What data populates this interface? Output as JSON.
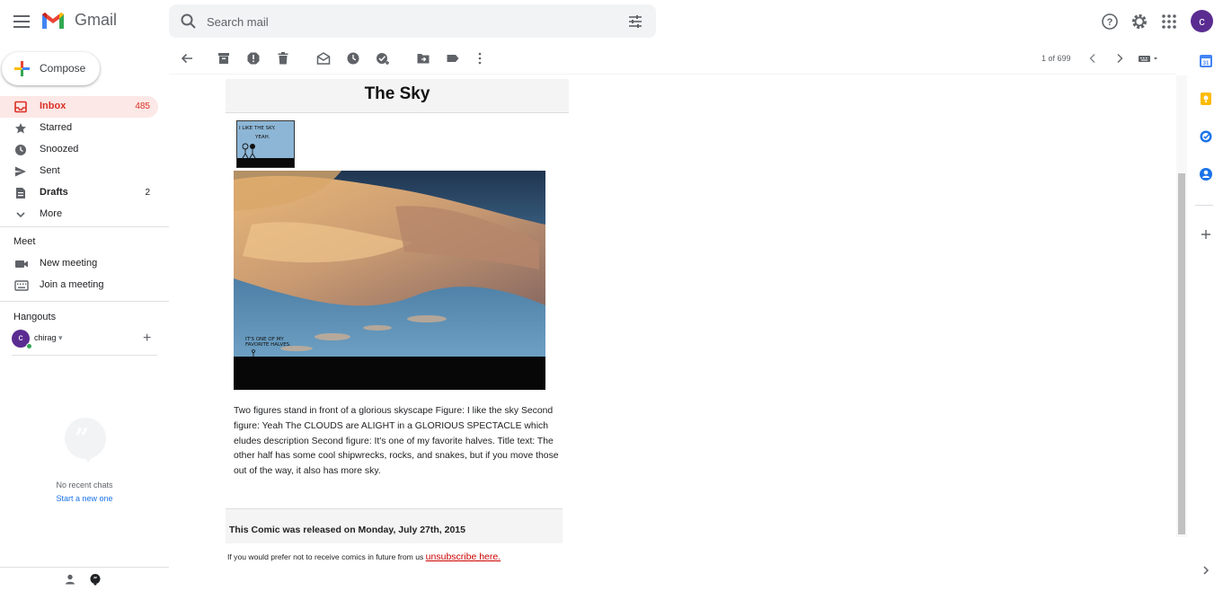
{
  "header": {
    "app_name": "Gmail",
    "search_placeholder": "Search mail",
    "avatar_letter": "c"
  },
  "sidebar": {
    "compose_label": "Compose",
    "items": [
      {
        "label": "Inbox",
        "count": "485",
        "icon": "inbox-icon",
        "active": true
      },
      {
        "label": "Starred",
        "count": "",
        "icon": "star-icon"
      },
      {
        "label": "Snoozed",
        "count": "",
        "icon": "clock-icon"
      },
      {
        "label": "Sent",
        "count": "",
        "icon": "send-icon"
      },
      {
        "label": "Drafts",
        "count": "2",
        "icon": "draft-icon"
      },
      {
        "label": "More",
        "count": "",
        "icon": "chevron-down-icon"
      }
    ],
    "meet": {
      "title": "Meet",
      "new_meeting": "New meeting",
      "join_meeting": "Join a meeting"
    },
    "hangouts": {
      "title": "Hangouts",
      "user_letter": "c",
      "user_name": "chirag",
      "no_chats": "No recent chats",
      "start_new": "Start a new one"
    }
  },
  "toolbar": {
    "pager": "1 of 699"
  },
  "email": {
    "title": "The Sky",
    "thumb_text_1": "I LIKE THE SKY.",
    "thumb_text_2": "YEAH.",
    "image_caption_1": "IT'S ONE OF MY",
    "image_caption_2": "FAVORITE HALVES.",
    "description": "Two figures stand in front of a glorious skyscape Figure: I like the sky Second figure: Yeah The CLOUDS are ALIGHT in a GLORIOUS SPECTACLE which eludes description Second figure: It's one of my favorite halves. Title text: The other half has some cool shipwrecks, rocks, and snakes, but if you move those out of the way, it also has more sky.",
    "release": "This Comic was released on Monday, July 27th, 2015",
    "unsubscribe_prefix": "If you would prefer not to receive comics in future from us",
    "unsubscribe_link": "unsubscribe here."
  },
  "colors": {
    "accent_red": "#d93025",
    "active_bg": "#fce8e6",
    "avatar": "#5a2c91",
    "link_blue": "#1a73e8"
  }
}
